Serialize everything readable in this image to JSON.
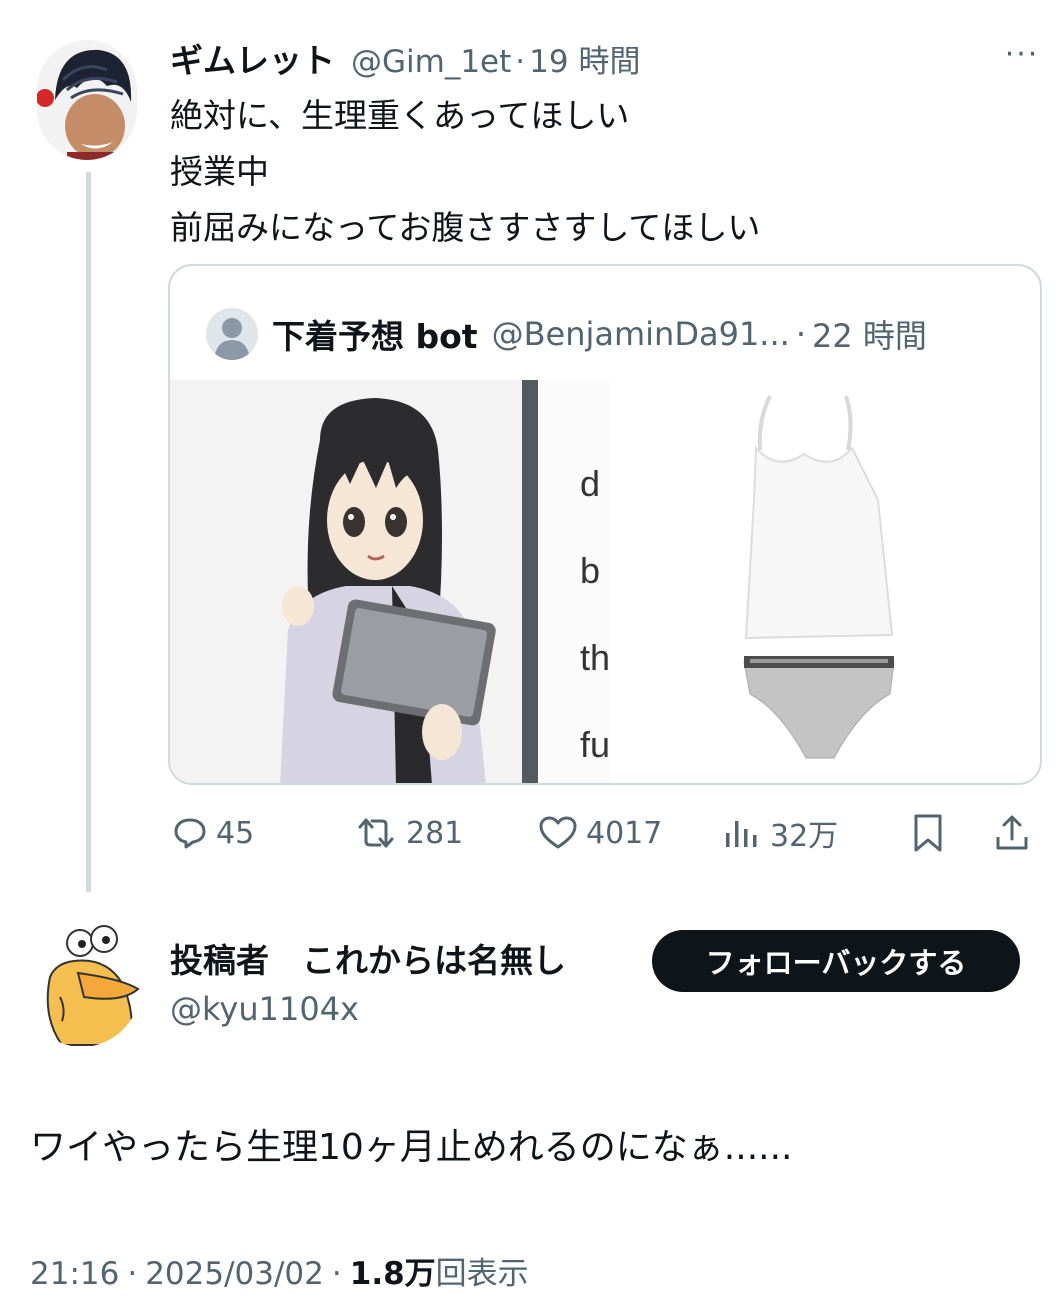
{
  "tweet": {
    "author_name": "ギムレット",
    "author_handle": "@Gim_1et",
    "separator": "·",
    "time_ago": "19 時間",
    "more_label": "···",
    "lines": [
      "絶対に、生理重くあってほしい",
      "授業中",
      "前屈みになってお腹さすさすしてほしい"
    ]
  },
  "quote": {
    "author_name": "下着予想 bot",
    "author_handle": "@BenjaminDa91...",
    "separator": "·",
    "time_ago": "22 時間",
    "poster_letters": [
      "d",
      "b",
      "th",
      "fu"
    ]
  },
  "actions": {
    "replies": "45",
    "retweets": "281",
    "likes": "4017",
    "views": "32万"
  },
  "reply": {
    "author_name": "投稿者　これからは名無し",
    "author_handle": "@kyu1104x",
    "follow_label": "フォローバックする",
    "text": "ワイやったら生理10ヶ月止めれるのになぁ......",
    "time": "21:16",
    "separator": "·",
    "date": "2025/03/02",
    "views_count": "1.8万",
    "views_suffix": "回表示"
  },
  "colors": {
    "text": "#0f1419",
    "secondary": "#536471",
    "border": "#cfd9de",
    "button_bg": "#0f1419"
  }
}
